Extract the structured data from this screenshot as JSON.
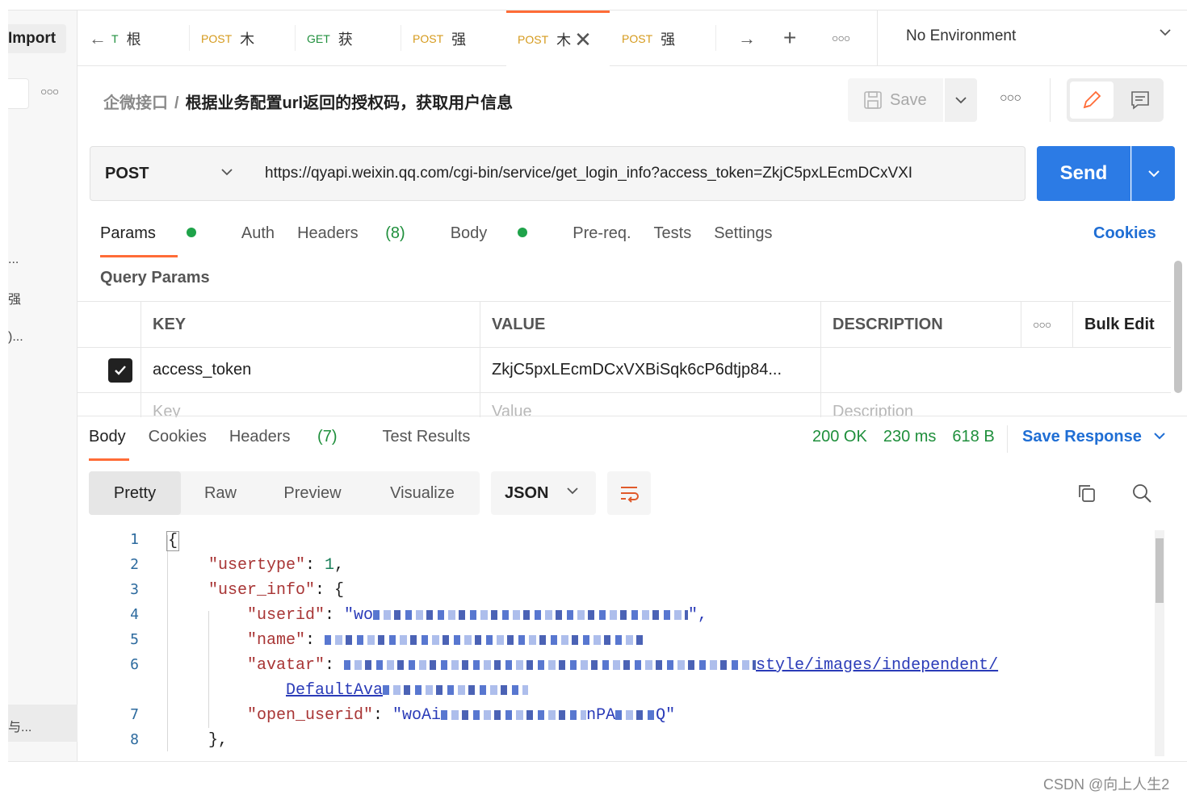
{
  "sidebar": {
    "import_label": "Import",
    "fragments": [
      "...",
      "强",
      ")...",
      "与..."
    ]
  },
  "tabs": {
    "items": [
      {
        "method": "T",
        "title": "根"
      },
      {
        "method": "POST",
        "title": "木"
      },
      {
        "method": "GET",
        "title": "获"
      },
      {
        "method": "POST",
        "title": "强"
      },
      {
        "method": "POST",
        "title": "木"
      },
      {
        "method": "POST",
        "title": "强"
      }
    ],
    "environment": "No Environment"
  },
  "breadcrumb": {
    "collection": "企微接口",
    "separator": "/",
    "request": "根据业务配置url返回的授权码，获取用户信息",
    "save_label": "Save"
  },
  "request": {
    "method": "POST",
    "url": "https://qyapi.weixin.qq.com/cgi-bin/service/get_login_info?access_token=ZkjC5pxLEcmDCxVXI",
    "send_label": "Send"
  },
  "request_tabs": {
    "params": "Params",
    "auth": "Auth",
    "headers": "Headers",
    "headers_count": "(8)",
    "body": "Body",
    "prereq": "Pre-req.",
    "tests": "Tests",
    "settings": "Settings",
    "cookies": "Cookies"
  },
  "query_params": {
    "title": "Query Params",
    "headers": {
      "key": "KEY",
      "value": "VALUE",
      "description": "DESCRIPTION",
      "bulk_edit": "Bulk Edit"
    },
    "rows": [
      {
        "key": "access_token",
        "value": "ZkjC5pxLEcmDCxVXBiSqk6cP6dtjp84...",
        "description": ""
      }
    ],
    "placeholders": {
      "key": "Key",
      "value": "Value",
      "description": "Description"
    }
  },
  "response": {
    "tabs": {
      "body": "Body",
      "cookies": "Cookies",
      "headers": "Headers",
      "headers_count": "(7)",
      "test_results": "Test Results"
    },
    "status": "200 OK",
    "time": "230 ms",
    "size": "618 B",
    "save_response": "Save Response",
    "formats": [
      "Pretty",
      "Raw",
      "Preview",
      "Visualize"
    ],
    "language": "JSON"
  },
  "code": {
    "line_numbers": [
      "1",
      "2",
      "3",
      "4",
      "5",
      "6",
      "7",
      "8"
    ],
    "lines": {
      "l1": "{",
      "l2_key": "\"usertype\"",
      "l2_val": "1",
      "l3_key": "\"user_info\"",
      "l3_brace": "{",
      "l4_key": "\"userid\"",
      "l4_val": "\"wo",
      "l5_key": "\"name\"",
      "l6_key": "\"avatar\"",
      "l6_link": "style/images/independent/",
      "l6b_link": "DefaultAva",
      "l7_key": "\"open_userid\"",
      "l7_val_start": "\"woAi",
      "l7_val_mid": "nPA",
      "l7_val_end": "Q\"",
      "l8": "},"
    }
  },
  "watermark": "CSDN @向上人生2"
}
